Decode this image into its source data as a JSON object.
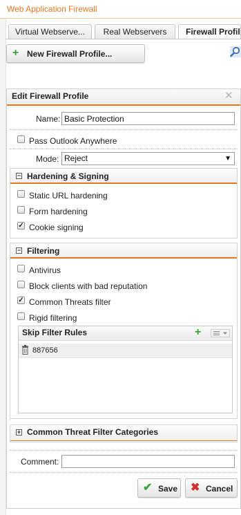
{
  "app": {
    "title": "Web Application Firewall"
  },
  "tabs": [
    {
      "label": "Virtual Webserve..."
    },
    {
      "label": "Real Webservers"
    },
    {
      "label": "Firewall Profil"
    }
  ],
  "toolbar": {
    "new_profile_label": "New Firewall Profile..."
  },
  "panel": {
    "title": "Edit Firewall Profile",
    "name_label": "Name:",
    "name_value": "Basic Protection",
    "pass_outlook_label": "Pass Outlook Anywhere",
    "pass_outlook_checked": false,
    "mode_label": "Mode:",
    "mode_value": "Reject"
  },
  "hardening": {
    "title": "Hardening & Signing",
    "items": [
      {
        "label": "Static URL hardening",
        "checked": false
      },
      {
        "label": "Form hardening",
        "checked": false
      },
      {
        "label": "Cookie signing",
        "checked": true
      }
    ]
  },
  "filtering": {
    "title": "Filtering",
    "items": [
      {
        "label": "Antivirus",
        "checked": false
      },
      {
        "label": "Block clients with bad reputation",
        "checked": false
      },
      {
        "label": "Common Threats filter",
        "checked": true
      },
      {
        "label": "Rigid filtering",
        "checked": false
      }
    ],
    "skip_rules": {
      "title": "Skip Filter Rules",
      "rows": [
        {
          "value": "887656"
        }
      ]
    }
  },
  "categories": {
    "title": "Common Threat Filter Categories"
  },
  "comment": {
    "label": "Comment:",
    "value": ""
  },
  "actions": {
    "save_label": "Save",
    "cancel_label": "Cancel"
  },
  "colors": {
    "accent": "#e87722",
    "add": "#3aa53a",
    "cancel": "#d0312d"
  }
}
